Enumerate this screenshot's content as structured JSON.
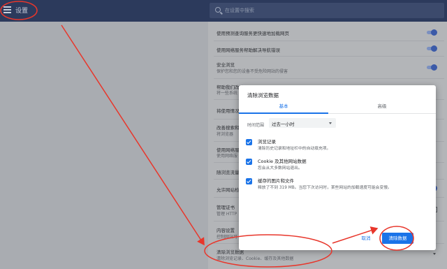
{
  "header": {
    "title": "设置",
    "search_placeholder": "在设置中搜索"
  },
  "settings_rows": {
    "r1": {
      "title": "使用预测查询服务更快速地加载网页"
    },
    "r2": {
      "title": "使用网络服务帮助解决导航错误"
    },
    "r3": {
      "title": "安全浏览",
      "sub": "保护您和您的设备不受危险网站的侵害"
    },
    "r4": {
      "title": "帮助我们改进",
      "sub": "将一些系统"
    },
    "r5": {
      "title": "将使用情况"
    },
    "r6": {
      "title": "改善搜索和",
      "sub": "将浏览器"
    },
    "r7": {
      "title": "使用网络服",
      "sub": "使用网络服"
    },
    "r8": {
      "title": "随浏览流量"
    },
    "r9": {
      "title": "允许网站检"
    },
    "r10": {
      "title": "管理证书",
      "sub": "管理 HTTP"
    },
    "r11": {
      "title": "内容设置",
      "sub": "控制网站可"
    },
    "r12": {
      "title": "清除浏览数据",
      "sub": "清除浏览记录、Cookie、缓存及其他数据"
    }
  },
  "dialog": {
    "title": "清除浏览数据",
    "tabs": {
      "basic": "基本",
      "advanced": "高级"
    },
    "time_range_label": "时间范围",
    "time_range_value": "过去一小时",
    "items": [
      {
        "title": "浏览记录",
        "sub": "清除历史记录和地址栏中的自动填充项。"
      },
      {
        "title": "Cookie 及其他网站数据",
        "sub": "您会从大多数网站退出。"
      },
      {
        "title": "缓存的图片和文件",
        "sub": "释放了不到 319 MB。当您下次访问时，某些网站的加载速度可能会变慢。"
      }
    ],
    "cancel_label": "取消",
    "clear_label": "清除数据"
  },
  "colors": {
    "accent": "#1a73e8",
    "header_bg": "#2c3a5c",
    "annotation": "#e8362b"
  }
}
